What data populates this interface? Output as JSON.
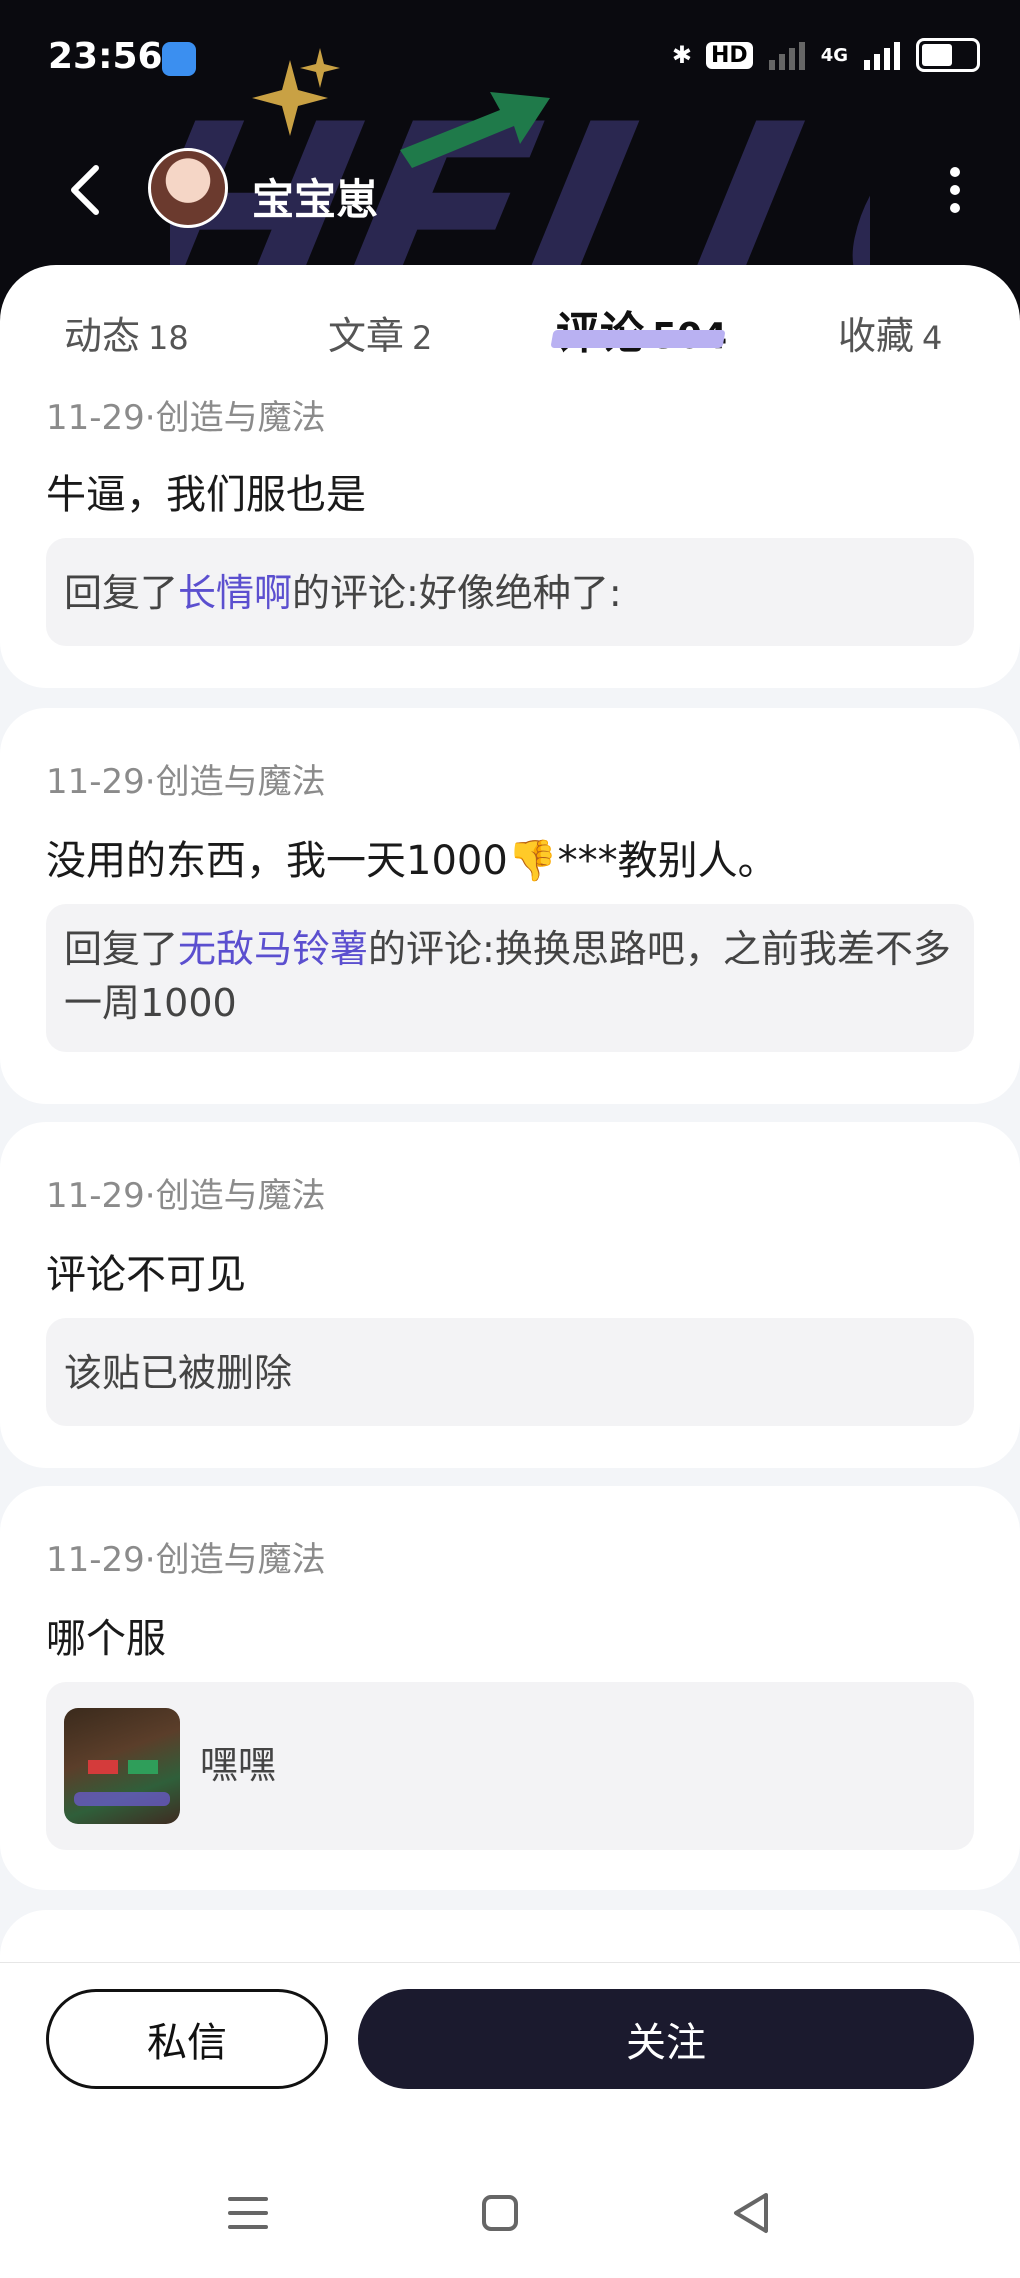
{
  "status_bar": {
    "time": "23:56",
    "hd": "HD",
    "network": "4G",
    "battery": "52"
  },
  "header": {
    "username": "宝宝崽"
  },
  "tabs": [
    {
      "label": "动态",
      "count": "18"
    },
    {
      "label": "文章",
      "count": "2"
    },
    {
      "label": "评论",
      "count": "504"
    },
    {
      "label": "收藏",
      "count": "4"
    }
  ],
  "comments": [
    {
      "meta": "11-29·创造与魔法",
      "text": "牛逼，我们服也是",
      "reply_prefix": "回复了",
      "reply_user": "长情啊",
      "reply_text": "的评论:好像绝种了:"
    },
    {
      "meta": "11-29·创造与魔法",
      "text_before": "没用的东西，我一天1000",
      "emoji": "👎",
      "text_after": "***教别人。",
      "reply_prefix": "回复了",
      "reply_user": "无敌马铃薯",
      "reply_text": "的评论:换换思路吧，之前我差不多一周1000"
    },
    {
      "meta": "11-29·创造与魔法",
      "text": "评论不可见",
      "reply_text": "该贴已被删除"
    },
    {
      "meta": "11-29·创造与魔法",
      "text": "哪个服",
      "reply_text": "嘿嘿"
    }
  ],
  "bottom": {
    "message_label": "私信",
    "follow_label": "关注"
  },
  "colors": {
    "accent_purple": "#5b4fcf",
    "follow_button": "#1b1a2e",
    "header_bg": "#0a0a0f"
  }
}
